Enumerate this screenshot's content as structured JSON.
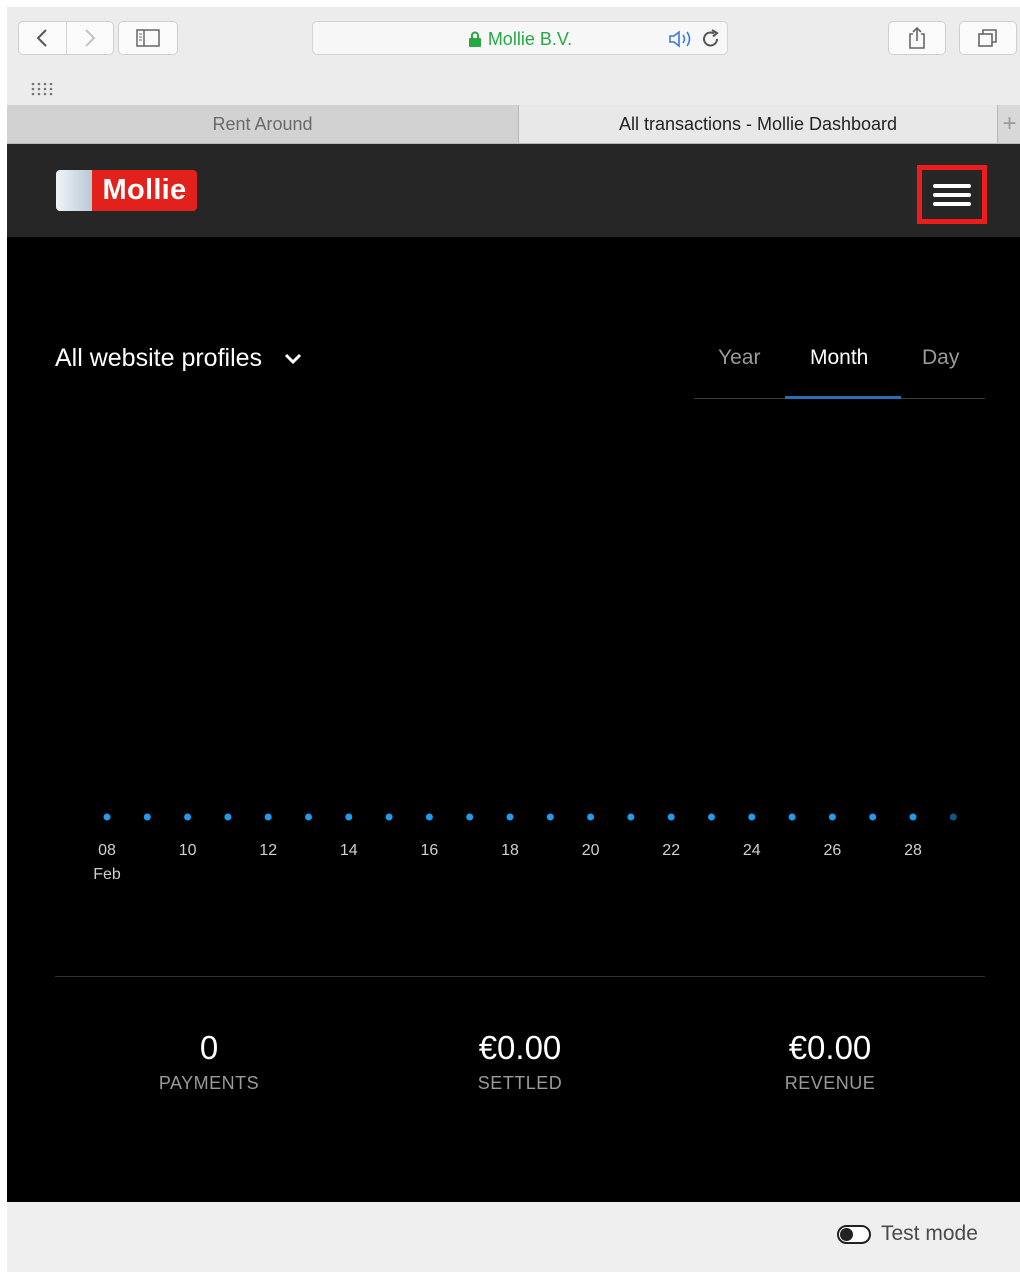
{
  "browser": {
    "address": "Mollie B.V.",
    "tabs": [
      "Rent Around",
      "All transactions - Mollie Dashboard"
    ],
    "new_tab_label": "+"
  },
  "header": {
    "logo_text": "Mollie"
  },
  "profile_selector": {
    "label": "All website profiles"
  },
  "period_tabs": {
    "items": [
      "Year",
      "Month",
      "Day"
    ],
    "selected": "Month"
  },
  "chart_data": {
    "type": "scatter",
    "x": [
      "08 Feb",
      "09",
      "10",
      "11",
      "12",
      "13",
      "14",
      "15",
      "16",
      "17",
      "18",
      "19",
      "20",
      "21",
      "22",
      "23",
      "24",
      "25",
      "26",
      "27",
      "28",
      "29"
    ],
    "values": [
      0,
      0,
      0,
      0,
      0,
      0,
      0,
      0,
      0,
      0,
      0,
      0,
      0,
      0,
      0,
      0,
      0,
      0,
      0,
      0,
      0,
      0
    ],
    "tick_labels": [
      "08",
      "10",
      "12",
      "14",
      "16",
      "18",
      "20",
      "22",
      "24",
      "26",
      "28"
    ],
    "month_label": "Feb",
    "color": "#1f9bf0",
    "grid": false
  },
  "stats": [
    {
      "value": "0",
      "label": "PAYMENTS"
    },
    {
      "value": "€0.00",
      "label": "SETTLED"
    },
    {
      "value": "€0.00",
      "label": "REVENUE"
    }
  ],
  "footer": {
    "test_mode_label": "Test mode",
    "test_mode_on": false
  },
  "colors": {
    "accent": "#2b6fb3",
    "brand_red": "#e3211c",
    "dot": "#1f9bf0"
  }
}
